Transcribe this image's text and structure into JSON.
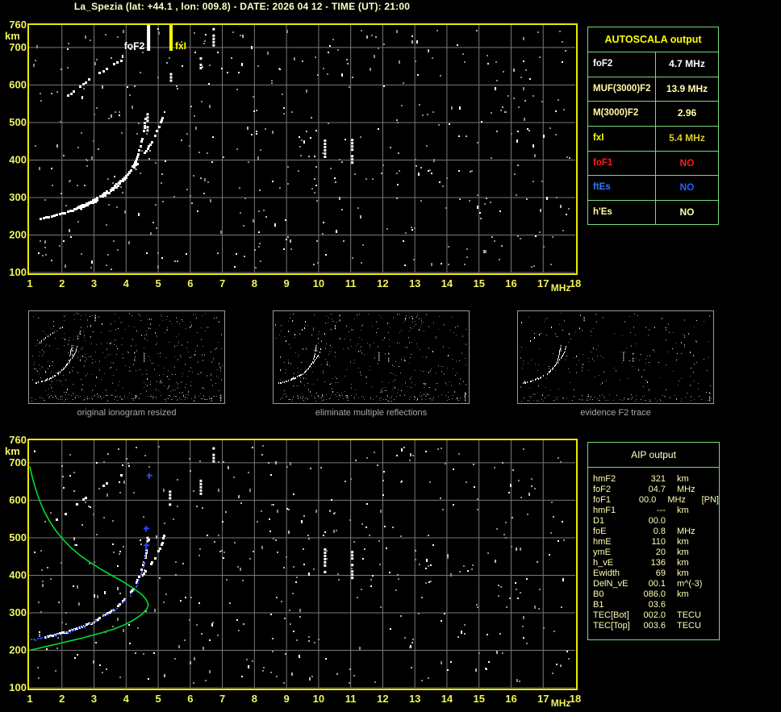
{
  "title": "La_Spezia (lat: +44.1 , lon: 009.8) - DATE: 2026 04 12 - TIME (UT): 21:00",
  "colors": {
    "background": "#000000",
    "axis_yellow": "#e9e900",
    "tick_label_yellow": "#f2f25e",
    "grid_gray": "#787878",
    "table_border_green": "#7ad87a",
    "trace_white": "#ffffff",
    "profile_green": "#00dd2e",
    "fitted_blue": "#2e45ff",
    "caption_gray": "#a9a9a9"
  },
  "autoscala_table": {
    "title": "AUTOSCALA output",
    "title_color": "#ffff00",
    "rows": [
      {
        "label": "foF2",
        "value": "4.7 MHz",
        "label_color": "#ffffff",
        "value_color": "#ffffff"
      },
      {
        "label": "MUF(3000)F2",
        "value": "13.9 MHz",
        "label_color": "#ffffa8",
        "value_color": "#ffffa8"
      },
      {
        "label": "M(3000)F2",
        "value": "2.96",
        "label_color": "#ffffa8",
        "value_color": "#ffffa8"
      },
      {
        "label": "fxI",
        "value": "5.4 MHz",
        "label_color": "#ffff00",
        "value_color": "#d9cd2e"
      },
      {
        "label": "foF1",
        "value": "NO",
        "label_color": "#ff1a1a",
        "value_color": "#ff1a1a"
      },
      {
        "label": "ftEs",
        "value": "NO",
        "label_color": "#3377ff",
        "value_color": "#1e62ff"
      },
      {
        "label": "h'Es",
        "value": "NO",
        "label_color": "#ffff9c",
        "value_color": "#ffff9c"
      }
    ]
  },
  "aip_table": {
    "title": "AIP output",
    "rows": [
      {
        "name": "hmF2",
        "value": "321",
        "unit": "km",
        "extra": ""
      },
      {
        "name": "foF2",
        "value": "04.7",
        "unit": "MHz",
        "extra": ""
      },
      {
        "name": "foF1",
        "value": "00.0",
        "unit": "MHz",
        "extra": "[PN]"
      },
      {
        "name": "hmF1",
        "value": "---",
        "unit": "km",
        "extra": ""
      },
      {
        "name": "D1",
        "value": "00.0",
        "unit": "",
        "extra": ""
      },
      {
        "name": "foE",
        "value": "0.8",
        "unit": "MHz",
        "extra": ""
      },
      {
        "name": "hmE",
        "value": "110",
        "unit": "km",
        "extra": ""
      },
      {
        "name": "ymE",
        "value": "20",
        "unit": "km",
        "extra": ""
      },
      {
        "name": "h_vE",
        "value": "136",
        "unit": "km",
        "extra": ""
      },
      {
        "name": "Ewidth",
        "value": "69",
        "unit": "km",
        "extra": ""
      },
      {
        "name": "DelN_vE",
        "value": "00.1",
        "unit": "m^(-3)",
        "extra": ""
      },
      {
        "name": "B0",
        "value": "086.0",
        "unit": "km",
        "extra": ""
      },
      {
        "name": "B1",
        "value": "03.6",
        "unit": "",
        "extra": ""
      },
      {
        "name": "TEC[Bot]",
        "value": "002.0",
        "unit": "TECU",
        "extra": ""
      },
      {
        "name": "TEC[Top]",
        "value": "003.6",
        "unit": "TECU",
        "extra": ""
      }
    ]
  },
  "panels": [
    {
      "caption": "original ionogram resized",
      "seed": 101,
      "noise": 430,
      "band": 120
    },
    {
      "caption": "eliminate multiple reflections",
      "seed": 202,
      "noise": 360,
      "band": 110
    },
    {
      "caption": "evidence F2 trace",
      "seed": 303,
      "noise": 200,
      "band": 90
    }
  ],
  "chart_data": [
    {
      "type": "scatter",
      "name": "recorded-ionogram",
      "xlabel": "MHz",
      "ylabel": "km",
      "xlim": [
        1,
        18
      ],
      "ylim": [
        100,
        760
      ],
      "xticks": [
        1,
        2,
        3,
        4,
        5,
        6,
        7,
        8,
        9,
        10,
        11,
        12,
        13,
        14,
        15,
        16,
        17,
        18
      ],
      "yticks": [
        760,
        700,
        600,
        500,
        400,
        300,
        200,
        100
      ],
      "grid": true,
      "noise_seed": 11,
      "noise_count": 460,
      "series": [
        {
          "name": "F2 ordinary echo trace",
          "style": "dotted-trace",
          "color": "#ffffff",
          "points": [
            [
              1.35,
              243
            ],
            [
              1.6,
              248
            ],
            [
              1.85,
              253
            ],
            [
              2.1,
              259
            ],
            [
              2.35,
              266
            ],
            [
              2.6,
              274
            ],
            [
              2.85,
              283
            ],
            [
              3.1,
              294
            ],
            [
              3.35,
              307
            ],
            [
              3.6,
              322
            ],
            [
              3.8,
              337
            ],
            [
              4.0,
              355
            ],
            [
              4.15,
              373
            ],
            [
              4.28,
              393
            ],
            [
              4.38,
              414
            ],
            [
              4.46,
              437
            ],
            [
              4.53,
              461
            ],
            [
              4.58,
              487
            ],
            [
              4.61,
              510
            ]
          ]
        },
        {
          "name": "F2 extraordinary echo trace",
          "style": "dotted-trace",
          "color": "#ffffff",
          "points": [
            [
              2.4,
              270
            ],
            [
              2.65,
              279
            ],
            [
              2.9,
              289
            ],
            [
              3.15,
              301
            ],
            [
              3.4,
              315
            ],
            [
              3.65,
              331
            ],
            [
              3.9,
              349
            ],
            [
              4.1,
              366
            ],
            [
              4.3,
              386
            ],
            [
              4.5,
              408
            ],
            [
              4.68,
              431
            ],
            [
              4.84,
              454
            ],
            [
              4.97,
              477
            ],
            [
              5.08,
              500
            ],
            [
              5.15,
              518
            ]
          ]
        },
        {
          "name": "second-hop multiple reflection",
          "style": "sparse-dots",
          "color": "#ffffff",
          "points": [
            [
              1.85,
              548
            ],
            [
              2.02,
              560
            ],
            [
              2.2,
              572
            ],
            [
              2.38,
              584
            ],
            [
              2.56,
              596
            ],
            [
              2.76,
              608
            ],
            [
              2.96,
              620
            ],
            [
              3.18,
              632
            ],
            [
              3.4,
              644
            ],
            [
              3.62,
              655
            ],
            [
              3.85,
              666
            ]
          ]
        },
        {
          "name": "vertical echo segments",
          "style": "vsegments",
          "color": "#ffffff",
          "segments": [
            [
              4.67,
              480,
              525
            ],
            [
              5.4,
              598,
              632
            ],
            [
              6.33,
              645,
              674
            ],
            [
              6.73,
              706,
              752
            ],
            [
              10.2,
              405,
              472
            ],
            [
              11.05,
              395,
              465
            ]
          ]
        }
      ],
      "markers": [
        {
          "label": "foF2",
          "f": 4.7,
          "color": "#ffffff",
          "label_side": "left"
        },
        {
          "label": "fxI",
          "f": 5.4,
          "color": "#ffff00",
          "label_side": "right"
        }
      ]
    },
    {
      "type": "scatter",
      "name": "scaled-ionogram-with-profile",
      "xlabel": "MHz",
      "ylabel": "km",
      "xlim": [
        1,
        18
      ],
      "ylim": [
        100,
        760
      ],
      "xticks": [
        1,
        2,
        3,
        4,
        5,
        6,
        7,
        8,
        9,
        10,
        11,
        12,
        13,
        14,
        15,
        16,
        17,
        18
      ],
      "yticks": [
        760,
        700,
        600,
        500,
        400,
        300,
        200,
        100
      ],
      "grid": true,
      "noise_seed": 77,
      "noise_count": 440,
      "series": [
        {
          "name": "F2 ordinary echo trace",
          "style": "dotted-trace",
          "color": "#ffffff",
          "points": [
            [
              1.5,
              235
            ],
            [
              1.8,
              241
            ],
            [
              2.1,
              248
            ],
            [
              2.4,
              256
            ],
            [
              2.7,
              265
            ],
            [
              3.0,
              276
            ],
            [
              3.25,
              288
            ],
            [
              3.5,
              302
            ],
            [
              3.75,
              318
            ],
            [
              3.95,
              335
            ],
            [
              4.15,
              355
            ],
            [
              4.3,
              376
            ],
            [
              4.42,
              398
            ],
            [
              4.52,
              422
            ],
            [
              4.6,
              448
            ],
            [
              4.66,
              474
            ],
            [
              4.7,
              495
            ]
          ]
        },
        {
          "name": "F2 extraordinary echo trace",
          "style": "dotted-trace",
          "color": "#ffffff",
          "points": [
            [
              4.5,
              400
            ],
            [
              4.7,
              420
            ],
            [
              4.9,
              445
            ],
            [
              5.05,
              470
            ],
            [
              5.15,
              492
            ],
            [
              5.22,
              512
            ]
          ]
        },
        {
          "name": "second-hop multiple reflection",
          "style": "sparse-dots",
          "color": "#ffffff",
          "points": [
            [
              1.85,
              548
            ],
            [
              2.02,
              560
            ],
            [
              2.2,
              572
            ],
            [
              2.38,
              584
            ],
            [
              2.56,
              596
            ],
            [
              2.76,
              608
            ],
            [
              2.96,
              620
            ],
            [
              3.18,
              632
            ],
            [
              3.4,
              644
            ],
            [
              3.62,
              655
            ],
            [
              3.85,
              666
            ]
          ]
        },
        {
          "name": "vertical echo segments",
          "style": "vsegments",
          "color": "#ffffff",
          "segments": [
            [
              4.67,
              493,
              520
            ],
            [
              5.37,
              585,
              626
            ],
            [
              6.33,
              615,
              655
            ],
            [
              6.73,
              707,
              750
            ],
            [
              10.2,
              405,
              472
            ],
            [
              11.05,
              395,
              465
            ]
          ]
        },
        {
          "name": "fitted F2 trace",
          "style": "blue-dots",
          "color": "#2e45ff",
          "points": [
            [
              1.05,
              228
            ],
            [
              1.25,
              231
            ],
            [
              1.45,
              234
            ],
            [
              1.65,
              238
            ],
            [
              1.85,
              242
            ],
            [
              2.05,
              246
            ],
            [
              2.25,
              251
            ],
            [
              2.45,
              257
            ],
            [
              2.65,
              263
            ],
            [
              2.85,
              270
            ],
            [
              3.05,
              278
            ],
            [
              3.25,
              287
            ],
            [
              3.45,
              297
            ],
            [
              3.65,
              309
            ],
            [
              3.85,
              322
            ],
            [
              4.0,
              334
            ],
            [
              4.15,
              348
            ],
            [
              4.28,
              363
            ],
            [
              4.38,
              380
            ],
            [
              4.46,
              398
            ],
            [
              4.52,
              417
            ],
            [
              4.57,
              437
            ],
            [
              4.6,
              455
            ],
            [
              4.62,
              470
            ]
          ]
        },
        {
          "name": "fitted trace asymptote points",
          "style": "blue-marks",
          "color": "#2e45ff",
          "points": [
            [
              4.63,
              480
            ],
            [
              4.62,
              525
            ],
            [
              4.72,
              666
            ]
          ]
        },
        {
          "name": "electron density profile",
          "style": "line",
          "color": "#00dd2e",
          "points": [
            [
              1.0,
              690
            ],
            [
              1.08,
              660
            ],
            [
              1.18,
              630
            ],
            [
              1.3,
              600
            ],
            [
              1.45,
              570
            ],
            [
              1.62,
              543
            ],
            [
              1.82,
              518
            ],
            [
              2.05,
              494
            ],
            [
              2.3,
              472
            ],
            [
              2.6,
              451
            ],
            [
              2.9,
              433
            ],
            [
              3.2,
              417
            ],
            [
              3.5,
              402
            ],
            [
              3.8,
              388
            ],
            [
              4.05,
              375
            ],
            [
              4.3,
              361
            ],
            [
              4.5,
              348
            ],
            [
              4.62,
              336
            ],
            [
              4.68,
              326
            ],
            [
              4.69,
              321
            ],
            [
              4.65,
              311
            ],
            [
              4.5,
              296
            ],
            [
              4.2,
              279
            ],
            [
              3.9,
              266
            ],
            [
              3.6,
              256
            ],
            [
              3.25,
              247
            ],
            [
              2.9,
              239
            ],
            [
              2.55,
              231
            ],
            [
              2.2,
              224
            ],
            [
              1.85,
              217
            ],
            [
              1.5,
              210
            ],
            [
              1.2,
              204
            ],
            [
              1.0,
              200
            ]
          ]
        }
      ],
      "markers": []
    }
  ]
}
